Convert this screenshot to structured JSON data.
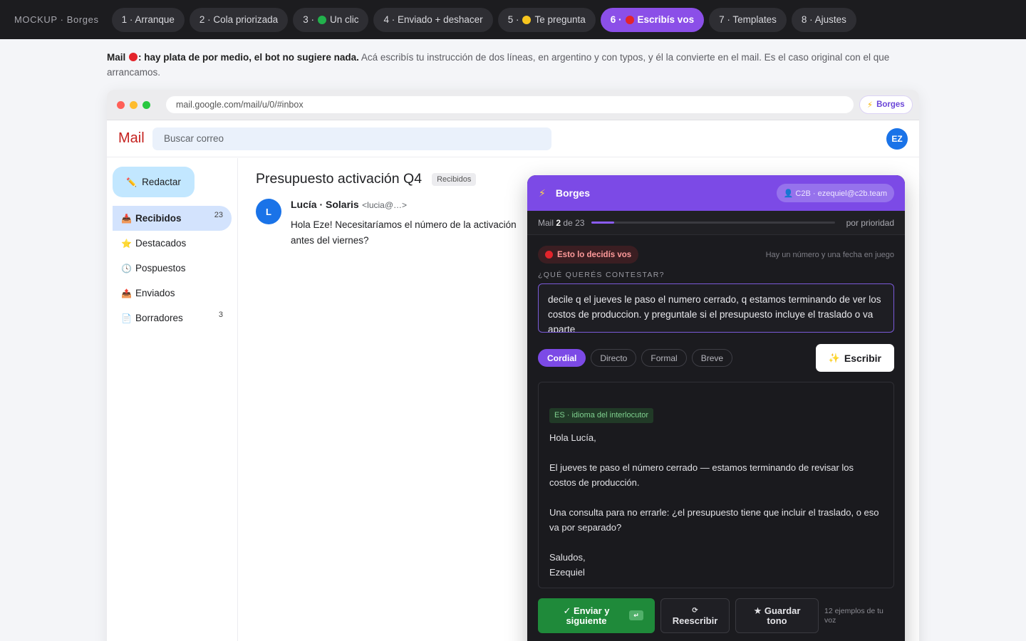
{
  "topnav": {
    "brand": "MOCKUP · Borges",
    "pills": [
      {
        "label": "1 · Arranque"
      },
      {
        "label": "2 · Cola priorizada"
      },
      {
        "prefix": "3 ·",
        "label": "Un clic",
        "dot": "#22b14c"
      },
      {
        "label": "4 · Enviado + deshacer"
      },
      {
        "prefix": "5 ·",
        "label": "Te pregunta",
        "dot": "#f7c51e"
      },
      {
        "prefix": "6 ·",
        "label": "Escribís vos",
        "dot": "#e3242b",
        "active": true
      },
      {
        "label": "7 · Templates"
      },
      {
        "label": "8 · Ajustes"
      }
    ]
  },
  "intro": {
    "lead_prefix": "Mail",
    "lead_suffix": ": hay plata de por medio, el bot no sugiere nada.",
    "text": "Acá escribís tu instrucción de dos líneas, en argentino y con typos, y él la convierte en el mail. Es el caso original con el que arrancamos."
  },
  "browser": {
    "url": "mail.google.com/mail/u/0/#inbox",
    "extension_label": "Borges"
  },
  "gmail": {
    "logo": "Mail",
    "search_placeholder": "Buscar correo",
    "avatar_initials": "EZ",
    "compose_label": "Redactar",
    "sidebar": [
      {
        "icon": "inbox-icon",
        "glyph": "📥",
        "label": "Recibidos",
        "count": "23",
        "active": true
      },
      {
        "icon": "star-icon",
        "glyph": "⭐",
        "label": "Destacados",
        "count": ""
      },
      {
        "icon": "clock-icon",
        "glyph": "🕓",
        "label": "Pospuestos",
        "count": ""
      },
      {
        "icon": "sent-icon",
        "glyph": "📤",
        "label": "Enviados",
        "count": ""
      },
      {
        "icon": "draft-icon",
        "glyph": "📄",
        "label": "Borradores",
        "count": "3"
      }
    ],
    "mail": {
      "subject": "Presupuesto activación Q4",
      "label": "Recibidos",
      "sender_initial": "L",
      "sender_name": "Lucía · Solaris",
      "sender_email": "<lucia@…>",
      "body": "Hola Eze! Necesitaríamos el número de la activación antes del viernes?"
    }
  },
  "panel": {
    "title": "Borges",
    "account": "👤 C2B · ezequiel@c2b.team",
    "progress": {
      "prefix": "Mail",
      "current": "2",
      "of_label": "de 23",
      "fraction": 0.092,
      "order": "por prioridad"
    },
    "decide_label": "Esto lo decidís vos",
    "decide_color": "#e3242b",
    "hint": "Hay un número y una fecha en juego",
    "question": "¿QUÉ QUERÉS CONTESTAR?",
    "instruction": "decile q el jueves le paso el numero cerrado, q estamos terminando de ver los costos de produccion. y preguntale si el presupuesto incluye el traslado o va aparte",
    "tones": [
      {
        "label": "Cordial",
        "selected": true
      },
      {
        "label": "Directo"
      },
      {
        "label": "Formal"
      },
      {
        "label": "Breve"
      }
    ],
    "write_label": "Escribir",
    "draft": {
      "lang": "ES · idioma del interlocutor",
      "greeting": "Hola Lucía,",
      "p1_a": "El jueves te paso el número cerrado — estamos terminando de revisar los",
      "p1_b": "costos de producción.",
      "p2_a": "Una consulta para no errarle: ¿el presupuesto tiene que incluir el traslado, o eso",
      "p2_b": "va por separado?",
      "closing": "Saludos,",
      "signature": "Ezequiel"
    },
    "actions": {
      "send": "✓ Enviar y siguiente",
      "send_key": "↵",
      "rewrite_icon": "⟳",
      "rewrite": "Reescribir",
      "save": "★ Guardar tono",
      "examples": "12 ejemplos de tu voz"
    }
  }
}
